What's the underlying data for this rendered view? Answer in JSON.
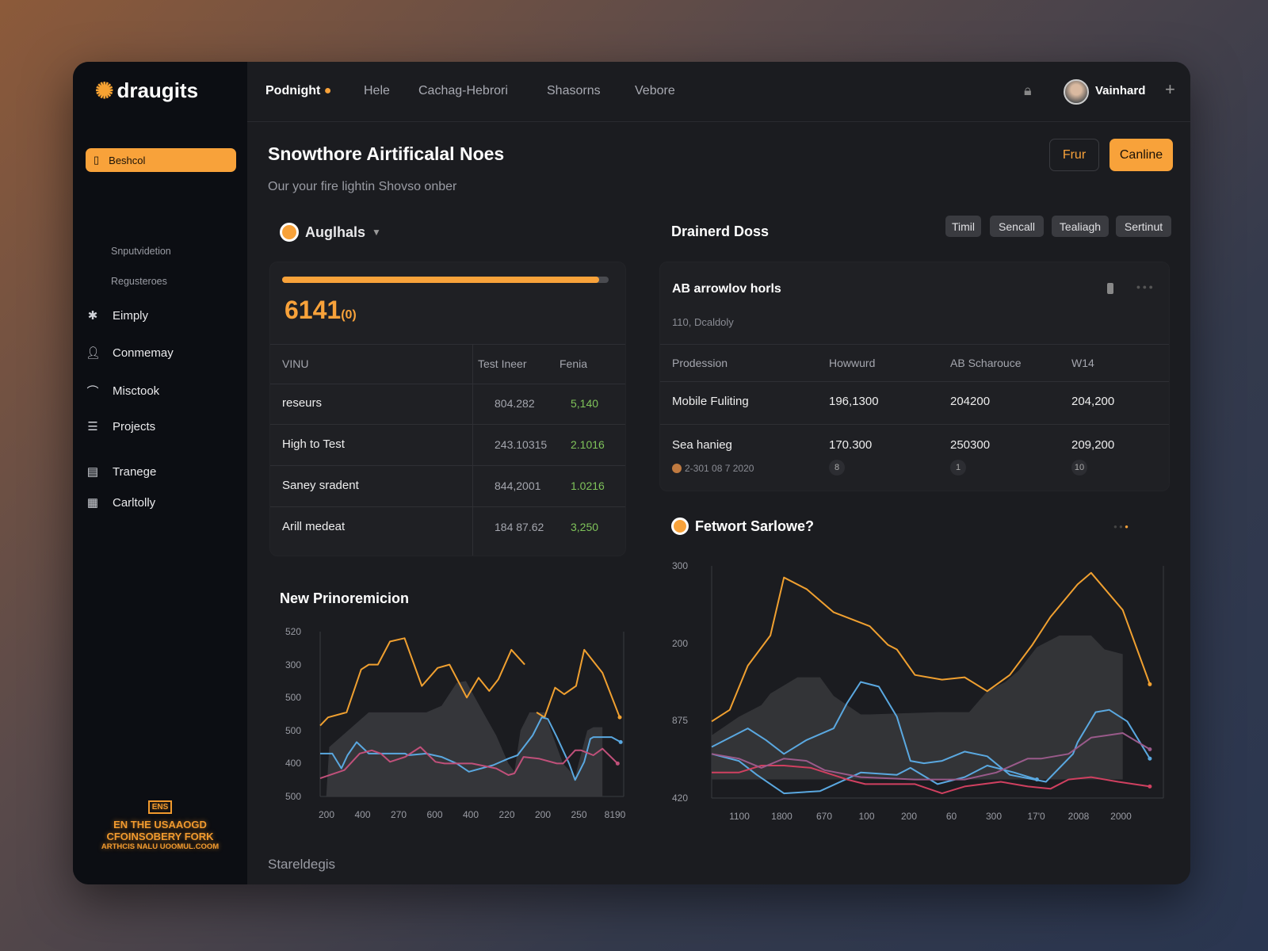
{
  "brand": {
    "name": "draugits",
    "accent": "#f8a23a"
  },
  "header": {
    "nav": [
      "Podnight",
      "Hele",
      "Cachag-Hebrori",
      "Shasorns",
      "Vebore"
    ],
    "user": "Vainhard"
  },
  "sidebar": {
    "active": "Beshcol",
    "subitems": [
      "Snputvidetion",
      "Regusteroes"
    ],
    "items": [
      {
        "label": "Eimply",
        "icon": "asterisk-icon"
      },
      {
        "label": "Conmemay",
        "icon": "user-icon"
      },
      {
        "label": "Misctook",
        "icon": "wifi-icon"
      },
      {
        "label": "Projects",
        "icon": "stack-icon"
      },
      {
        "label": "Tranege",
        "icon": "report-icon"
      },
      {
        "label": "Carltolly",
        "icon": "grid-icon"
      }
    ],
    "promo": {
      "badge": "ENS",
      "line1": "EN THE USAAOGD",
      "line2": "CFOINSOBERY FORK",
      "line3": "ARTHCIS NALU UOOMUL.COOM"
    }
  },
  "page": {
    "title": "Snowthore Airtificalal Noes",
    "subtitle": "Our your fire lightin Shovso onber",
    "btn_secondary": "Frur",
    "btn_primary": "Canline",
    "footer_label": "Stareldegis"
  },
  "left_panel": {
    "title": "Auglhals",
    "progress": 0.97,
    "big_value": "6141",
    "big_suffix": "(0)",
    "columns": [
      "VINU",
      "Test Ineer",
      "Fenia"
    ],
    "rows": [
      [
        "reseurs",
        "804.282",
        "5,140"
      ],
      [
        "High to Test",
        "243.10315",
        "2.1016"
      ],
      [
        "Saney sradent",
        "844,2001",
        "1.0216"
      ],
      [
        "Arill medeat",
        "184 87.62",
        "3,250"
      ]
    ]
  },
  "right_panel": {
    "title": "Drainerd Doss",
    "tags": [
      "Timil",
      "Sencall",
      "Tealiagh",
      "Sertinut"
    ],
    "card": {
      "title": "AB arrowlov horls",
      "subtitle": "110, Dcaldoly",
      "columns": [
        "Prodession",
        "Howwurd",
        "AB Scharouce",
        "W14"
      ],
      "rows": [
        [
          "Mobile Fuliting",
          "196,1300",
          "204200",
          "204,200"
        ],
        [
          "Sea hanieg",
          "170.300",
          "250300",
          "209,200"
        ]
      ],
      "row_note": "2-301 08 7 2020",
      "badges": [
        "8",
        "1",
        "10"
      ]
    }
  },
  "chart_data": [
    {
      "type": "line",
      "title": "New Prinoremicion",
      "xlim": [
        0,
        100
      ],
      "ylim": [
        0,
        100
      ],
      "x_tick_labels": [
        "200",
        "400",
        "270",
        "600",
        "400",
        "220",
        "200",
        "250",
        "8190"
      ],
      "y_tick_labels": [
        "520",
        "300",
        "500",
        "500",
        "400",
        "500"
      ],
      "grid": false,
      "colors": {
        "orange": "#f0a030",
        "blue": "#5aa8e0",
        "pink": "#c0507a",
        "area": "#3a3b3f"
      },
      "area": [
        [
          2,
          0
        ],
        [
          3,
          30
        ],
        [
          16,
          51
        ],
        [
          35,
          51
        ],
        [
          40,
          55
        ],
        [
          45,
          69
        ],
        [
          48,
          70
        ],
        [
          54,
          50
        ],
        [
          58,
          37
        ],
        [
          62,
          20
        ],
        [
          64,
          15
        ],
        [
          66,
          40
        ],
        [
          69,
          51
        ],
        [
          74,
          51
        ],
        [
          76,
          40
        ],
        [
          80,
          20
        ],
        [
          84,
          12
        ],
        [
          88,
          40
        ],
        [
          90,
          42
        ],
        [
          93,
          42
        ],
        [
          93,
          0
        ]
      ],
      "series": [
        {
          "color": "orange",
          "points": [
            [
              0,
              43
            ],
            [
              2.6,
              48
            ],
            [
              8.7,
              51
            ],
            [
              13.5,
              77
            ],
            [
              16,
              80
            ],
            [
              19,
              80
            ],
            [
              23,
              94
            ],
            [
              27.8,
              96
            ],
            [
              33.5,
              67
            ],
            [
              38.7,
              78
            ],
            [
              42.6,
              80
            ],
            [
              48.3,
              60
            ],
            [
              52.2,
              72
            ],
            [
              55.7,
              64
            ],
            [
              58.7,
              71
            ],
            [
              63,
              89
            ],
            [
              67.4,
              80
            ],
            null,
            [
              71.3,
              51
            ],
            [
              73.9,
              48
            ],
            [
              77.4,
              66
            ],
            [
              80.4,
              62
            ],
            [
              84.3,
              67
            ],
            [
              87,
              89
            ],
            [
              93,
              75
            ],
            [
              98.7,
              48
            ]
          ]
        },
        {
          "color": "blue",
          "points": [
            [
              0,
              26
            ],
            [
              4,
              26
            ],
            [
              7,
              17
            ],
            [
              9,
              25
            ],
            [
              12,
              33
            ],
            [
              16,
              26
            ],
            [
              20,
              26
            ],
            [
              28,
              26
            ],
            [
              29,
              25
            ],
            [
              35,
              26
            ],
            [
              40,
              24
            ],
            [
              45,
              20
            ],
            [
              49,
              15
            ],
            [
              57,
              19
            ],
            [
              62,
              23
            ],
            [
              65,
              25
            ],
            [
              70,
              37
            ],
            [
              73,
              48
            ],
            [
              75,
              47
            ],
            [
              78,
              36
            ],
            [
              82,
              20
            ],
            [
              84,
              10
            ],
            [
              87,
              21
            ],
            [
              89,
              35
            ],
            [
              90,
              36
            ],
            [
              96,
              36
            ],
            [
              99,
              33
            ]
          ]
        },
        {
          "color": "pink",
          "points": [
            [
              0,
              11
            ],
            [
              8,
              16
            ],
            [
              13,
              26
            ],
            [
              17,
              28
            ],
            [
              20,
              26
            ],
            [
              23,
              21
            ],
            [
              28,
              24
            ],
            [
              33,
              30
            ],
            [
              38,
              21
            ],
            [
              41,
              20
            ],
            [
              50,
              20
            ],
            [
              58,
              17
            ],
            [
              62,
              13
            ],
            [
              64,
              14
            ],
            [
              67,
              24
            ],
            [
              72,
              23
            ],
            [
              78,
              20
            ],
            [
              80,
              20
            ],
            [
              84,
              28
            ],
            [
              86,
              28
            ],
            [
              90,
              25
            ],
            [
              93,
              29
            ],
            [
              98,
              20
            ]
          ]
        }
      ]
    },
    {
      "type": "line",
      "title": "Fetwort Sarlowe?",
      "xlim": [
        0,
        100
      ],
      "ylim": [
        0,
        100
      ],
      "x_tick_labels": [
        "1100",
        "1800",
        "670",
        "100",
        "200",
        "60",
        "300",
        "17'0",
        "2008",
        "2000"
      ],
      "y_tick_labels": [
        "300",
        "200",
        "875",
        "420"
      ],
      "grid": false,
      "colors": {
        "orange": "#f0a030",
        "blue": "#5aa8e0",
        "red": "#d04060",
        "purple": "#9a5a8a",
        "area": "#37383c"
      },
      "area": [
        [
          0,
          27
        ],
        [
          6,
          35
        ],
        [
          11,
          40
        ],
        [
          13,
          45
        ],
        [
          19,
          52
        ],
        [
          24,
          52
        ],
        [
          27,
          44
        ],
        [
          33,
          36
        ],
        [
          35,
          36
        ],
        [
          50,
          37
        ],
        [
          57,
          37
        ],
        [
          61,
          46
        ],
        [
          65,
          50
        ],
        [
          68,
          55
        ],
        [
          72,
          65
        ],
        [
          77,
          70
        ],
        [
          84,
          70
        ],
        [
          87,
          64
        ],
        [
          91,
          62
        ],
        [
          91,
          8
        ],
        [
          0,
          8
        ]
      ],
      "series": [
        {
          "color": "orange",
          "points": [
            [
              0,
              33
            ],
            [
              4,
              38
            ],
            [
              8,
              57
            ],
            [
              13,
              70
            ],
            [
              16,
              95
            ],
            [
              21,
              90
            ],
            [
              27,
              80
            ],
            [
              35,
              74
            ],
            [
              39,
              66
            ],
            [
              41,
              64
            ],
            [
              45,
              53
            ],
            [
              51,
              51
            ],
            [
              56,
              52
            ],
            [
              61,
              46
            ],
            [
              66,
              53
            ],
            [
              71,
              66
            ],
            [
              75,
              78
            ],
            [
              81,
              92
            ],
            [
              84,
              97
            ],
            [
              91,
              81
            ],
            [
              97,
              49
            ]
          ]
        },
        {
          "color": "blue",
          "points": [
            [
              0,
              22
            ],
            [
              8,
              30
            ],
            [
              12,
              25
            ],
            [
              16,
              19
            ],
            [
              21,
              25
            ],
            [
              27,
              30
            ],
            [
              30,
              41
            ],
            [
              33,
              50
            ],
            [
              37,
              48
            ],
            [
              41,
              35
            ],
            [
              44,
              16
            ],
            [
              47,
              15
            ],
            [
              51,
              16
            ],
            [
              56,
              20
            ],
            [
              61,
              18
            ],
            [
              66,
              10
            ],
            [
              74,
              7
            ],
            [
              80,
              19
            ],
            [
              81,
              24
            ],
            [
              85,
              37
            ],
            [
              88,
              38
            ],
            [
              92,
              33
            ],
            [
              97,
              17
            ]
          ]
        },
        {
          "color": "blue",
          "points": [
            [
              0,
              19
            ],
            [
              6,
              16
            ],
            [
              10,
              10
            ],
            [
              16,
              2
            ],
            [
              24,
              3
            ],
            [
              33,
              11
            ],
            [
              41,
              10
            ],
            [
              44,
              13
            ],
            [
              50,
              6
            ],
            [
              56,
              9
            ],
            [
              61,
              14
            ],
            [
              67,
              11
            ],
            [
              72,
              8
            ]
          ]
        },
        {
          "color": "red",
          "points": [
            [
              0,
              11
            ],
            [
              6,
              11
            ],
            [
              11,
              14
            ],
            [
              16,
              14
            ],
            [
              22,
              13
            ],
            [
              30,
              8
            ],
            [
              34,
              6
            ],
            [
              45,
              6
            ],
            [
              51,
              2
            ],
            [
              56,
              5
            ],
            [
              64,
              7
            ],
            [
              70,
              5
            ],
            [
              75,
              4
            ],
            [
              79,
              8
            ],
            [
              84,
              9
            ],
            [
              90,
              7
            ],
            [
              97,
              5
            ]
          ]
        },
        {
          "color": "purple",
          "points": [
            [
              0,
              19
            ],
            [
              6,
              17
            ],
            [
              11,
              13
            ],
            [
              16,
              17
            ],
            [
              21,
              16
            ],
            [
              25,
              12
            ],
            [
              33,
              9
            ],
            [
              45,
              8
            ],
            [
              56,
              8
            ],
            [
              63,
              11
            ],
            [
              70,
              17
            ],
            [
              73,
              17
            ],
            [
              79,
              19
            ],
            [
              84,
              26
            ],
            [
              91,
              28
            ],
            [
              97,
              21
            ]
          ]
        }
      ]
    }
  ]
}
